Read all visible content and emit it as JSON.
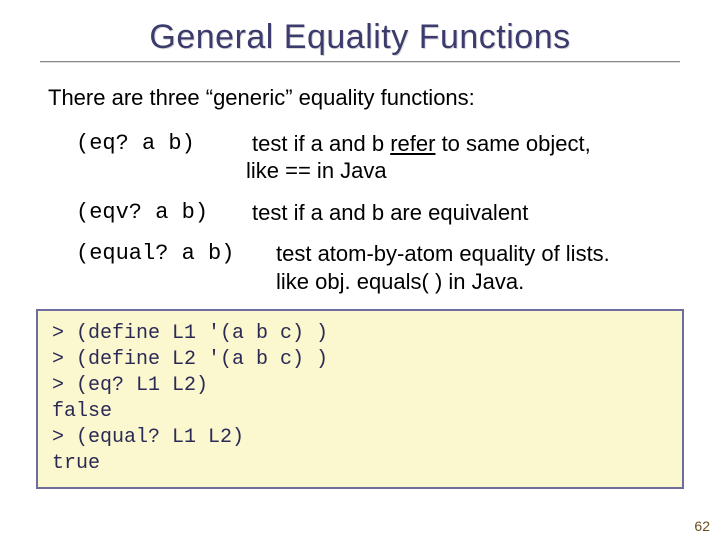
{
  "title": "General Equality Functions",
  "intro": "There are three “generic” equality functions:",
  "functions": {
    "eq": {
      "code": "(eq? a b)",
      "desc_parts": {
        "a": "test if a and b ",
        "refer": "refer",
        "b": " to same object,"
      },
      "desc_line2": "like == in Java"
    },
    "eqv": {
      "code": "(eqv? a b)",
      "desc": "test if a and b are equivalent"
    },
    "equal": {
      "code": "(equal? a b)",
      "desc_line1": "test atom-by-atom equality of lists.",
      "desc_line2": "like obj. equals( ) in Java."
    }
  },
  "repl": "> (define L1 '(a b c) )\n> (define L2 '(a b c) )\n> (eq? L1 L2)\nfalse\n> (equal? L1 L2)\ntrue",
  "page_number": "62"
}
